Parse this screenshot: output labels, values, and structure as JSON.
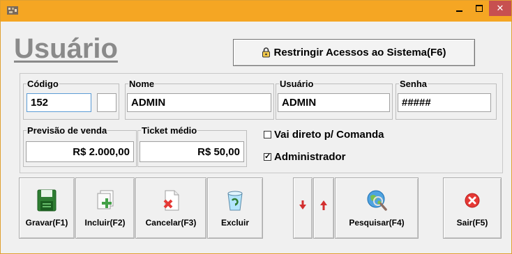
{
  "window": {
    "minimize_glyph": "",
    "close_glyph": "✕"
  },
  "page_title": "Usuário",
  "restrict_button": {
    "label": "Restringir Acessos ao Sistema(F6)"
  },
  "fields": {
    "codigo": {
      "label": "Código",
      "value": "152"
    },
    "nome": {
      "label": "Nome",
      "value": "ADMIN"
    },
    "usuario": {
      "label": "Usuário",
      "value": "ADMIN"
    },
    "senha": {
      "label": "Senha",
      "value": "#####"
    },
    "previsao": {
      "label": "Previsão de venda",
      "value": "R$ 2.000,00"
    },
    "ticket": {
      "label": "Ticket médio",
      "value": "R$ 50,00"
    }
  },
  "checkboxes": {
    "vai_direto": {
      "label": "Vai direto p/ Comanda",
      "checked": false,
      "mark": ""
    },
    "administrador": {
      "label": "Administrador",
      "checked": true,
      "mark": "✓"
    }
  },
  "toolbar": {
    "gravar": {
      "label": "Gravar(F1)",
      "icon": "floppy-disk-icon"
    },
    "incluir": {
      "label": "Incluir(F2)",
      "icon": "add-document-icon"
    },
    "cancelar": {
      "label": "Cancelar(F3)",
      "icon": "cancel-document-icon"
    },
    "excluir": {
      "label": "Excluir",
      "icon": "recycle-bin-icon"
    },
    "down": {
      "label": "",
      "icon": "arrow-down-icon"
    },
    "up": {
      "label": "",
      "icon": "arrow-up-icon"
    },
    "pesquisar": {
      "label": "Pesquisar(F4)",
      "icon": "search-globe-icon"
    },
    "sair": {
      "label": "Sair(F5)",
      "icon": "exit-icon"
    }
  },
  "colors": {
    "titlebar": "#f5a623",
    "close_button": "#c75050",
    "title_text": "#8a8a8a"
  }
}
